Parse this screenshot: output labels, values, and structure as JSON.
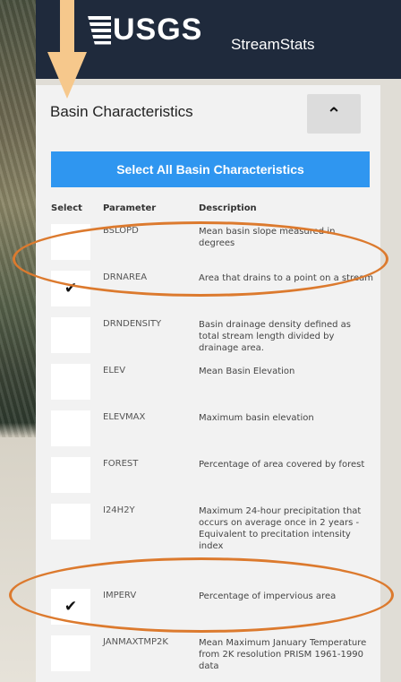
{
  "header": {
    "logo_text": "USGS",
    "app_name": "StreamStats"
  },
  "panel": {
    "title": "Basin Characteristics",
    "collapse_icon": "chevron-up-icon",
    "select_all_label": "Select All Basin Characteristics"
  },
  "table": {
    "columns": [
      "Select",
      "Parameter",
      "Description"
    ],
    "rows": [
      {
        "checked": false,
        "parameter": "BSLOPD",
        "description": "Mean basin slope measured in degrees"
      },
      {
        "checked": true,
        "parameter": "DRNAREA",
        "description": "Area that drains to a point on a stream"
      },
      {
        "checked": false,
        "parameter": "DRNDENSITY",
        "description": "Basin drainage density defined as total stream length divided by drainage area."
      },
      {
        "checked": false,
        "parameter": "ELEV",
        "description": "Mean Basin Elevation"
      },
      {
        "checked": false,
        "parameter": "ELEVMAX",
        "description": "Maximum basin elevation"
      },
      {
        "checked": false,
        "parameter": "FOREST",
        "description": "Percentage of area covered by forest"
      },
      {
        "checked": false,
        "parameter": "I24H2Y",
        "description": "Maximum 24-hour precipitation that occurs on average once in 2 years - Equivalent to precitation intensity index"
      },
      {
        "checked": true,
        "parameter": "IMPERV",
        "description": "Percentage of impervious area"
      },
      {
        "checked": false,
        "parameter": "JANMAXTMP2K",
        "description": "Mean Maximum January Temperature from 2K resolution PRISM 1961-1990 data"
      }
    ]
  },
  "colors": {
    "header_bg": "#1f2a3c",
    "accent_blue": "#2f96f0",
    "annotation_orange": "#dc7a2e",
    "arrow": "#f6c88c"
  }
}
